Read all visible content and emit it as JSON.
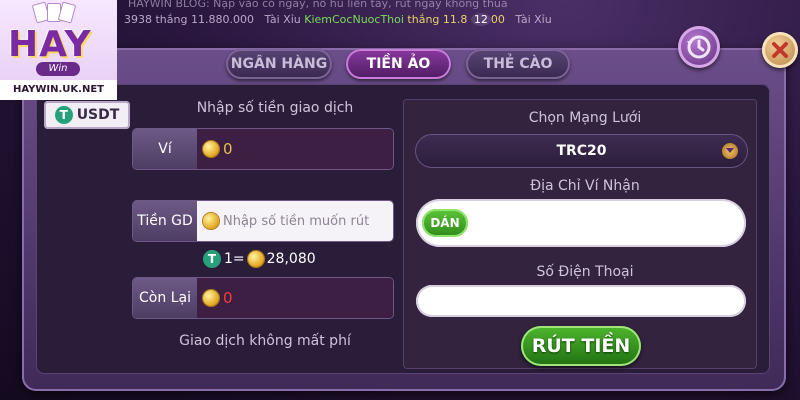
{
  "ticker": {
    "line1": "HAYWIN BLOG: Nạp vào có ngay, nổ hũ liền tay, rút ngay không thua",
    "line2_prefix": "3938 thắng 11.880.000",
    "line2_mid": "Tài Xỉu",
    "line2_user": "KiemCocNuocThoi",
    "line2_win": "thắng 11.8",
    "line2_badge": "12",
    "line2_tail": "00",
    "line2_game2": "Tài Xỉu"
  },
  "logo": {
    "brand": "HAY",
    "sub": "Win",
    "url": "HAYWIN.UK.NET"
  },
  "tabs": [
    {
      "label": "NGÂN HÀNG",
      "active": false
    },
    {
      "label": "TIỀN ẢO",
      "active": true
    },
    {
      "label": "THẺ CÀO",
      "active": false
    }
  ],
  "currency_tab": {
    "label": "USDT",
    "icon": "tether-icon"
  },
  "left": {
    "heading": "Nhập số tiền giao dịch",
    "wallet_label": "Ví",
    "wallet_value": "0",
    "amount_label": "Tiền GD",
    "amount_placeholder": "Nhập số tiền muốn rút",
    "rate_left": "1=",
    "rate_value": "28,080",
    "remain_label": "Còn Lại",
    "remain_value": "0",
    "note": "Giao dịch không mất phí"
  },
  "right": {
    "network_heading": "Chọn Mạng Lưới",
    "network_value": "TRC20",
    "address_heading": "Địa Chỉ Ví Nhận",
    "paste_label": "DÁN",
    "phone_heading": "Số Điện Thoại",
    "submit_label": "RÚT TIỀN"
  },
  "colors": {
    "accent_green": "#3fa322",
    "coin_gold": "#e2a41b",
    "tether_green": "#26a17b",
    "remain_red": "#ff3b3b"
  }
}
